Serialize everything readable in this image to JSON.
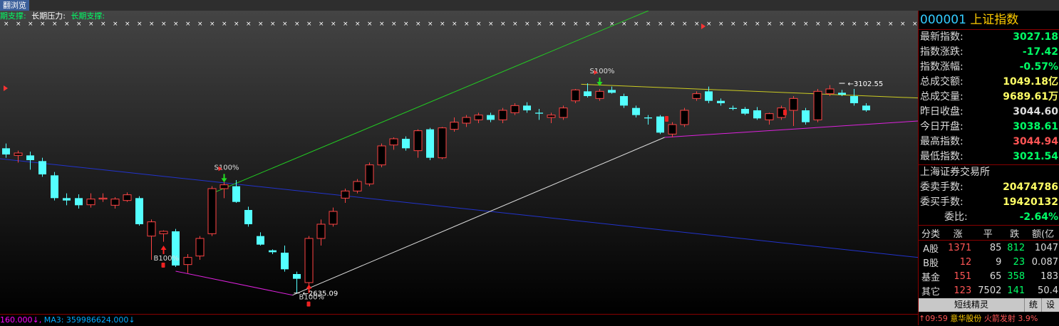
{
  "window": {
    "tab_label": "翻浏览"
  },
  "indicator_bar": {
    "items": [
      {
        "text": "期支撑:",
        "color": "#00ff66"
      },
      {
        "text": "长期压力:",
        "color": "#ffffff"
      },
      {
        "text": "长期支撑:",
        "color": "#00ff66"
      }
    ]
  },
  "chart_data": {
    "type": "candlestick",
    "ylim": [
      2600,
      3200
    ],
    "candles": [
      {
        "o": 2925,
        "h": 2935,
        "l": 2905,
        "c": 2912
      },
      {
        "o": 2910,
        "h": 2920,
        "l": 2895,
        "c": 2915
      },
      {
        "o": 2910,
        "h": 2918,
        "l": 2880,
        "c": 2900
      },
      {
        "o": 2898,
        "h": 2905,
        "l": 2865,
        "c": 2870
      },
      {
        "o": 2868,
        "h": 2875,
        "l": 2815,
        "c": 2820
      },
      {
        "o": 2820,
        "h": 2830,
        "l": 2805,
        "c": 2815
      },
      {
        "o": 2820,
        "h": 2828,
        "l": 2798,
        "c": 2805
      },
      {
        "o": 2806,
        "h": 2830,
        "l": 2800,
        "c": 2818
      },
      {
        "o": 2818,
        "h": 2830,
        "l": 2812,
        "c": 2820
      },
      {
        "o": 2805,
        "h": 2822,
        "l": 2798,
        "c": 2818
      },
      {
        "o": 2815,
        "h": 2832,
        "l": 2812,
        "c": 2827
      },
      {
        "o": 2820,
        "h": 2824,
        "l": 2762,
        "c": 2765
      },
      {
        "o": 2740,
        "h": 2775,
        "l": 2690,
        "c": 2770
      },
      {
        "o": 2745,
        "h": 2752,
        "l": 2728,
        "c": 2750
      },
      {
        "o": 2750,
        "h": 2755,
        "l": 2675,
        "c": 2678
      },
      {
        "o": 2680,
        "h": 2702,
        "l": 2662,
        "c": 2695
      },
      {
        "o": 2698,
        "h": 2740,
        "l": 2690,
        "c": 2735
      },
      {
        "o": 2745,
        "h": 2845,
        "l": 2740,
        "c": 2840
      },
      {
        "o": 2840,
        "h": 2860,
        "l": 2820,
        "c": 2848
      },
      {
        "o": 2845,
        "h": 2858,
        "l": 2810,
        "c": 2812
      },
      {
        "o": 2795,
        "h": 2802,
        "l": 2760,
        "c": 2765
      },
      {
        "o": 2740,
        "h": 2748,
        "l": 2720,
        "c": 2722
      },
      {
        "o": 2710,
        "h": 2712,
        "l": 2702,
        "c": 2706
      },
      {
        "o": 2705,
        "h": 2720,
        "l": 2665,
        "c": 2670
      },
      {
        "o": 2660,
        "h": 2665,
        "l": 2620,
        "c": 2650
      },
      {
        "o": 2642,
        "h": 2740,
        "l": 2635,
        "c": 2735
      },
      {
        "o": 2735,
        "h": 2775,
        "l": 2720,
        "c": 2765
      },
      {
        "o": 2765,
        "h": 2800,
        "l": 2760,
        "c": 2792
      },
      {
        "o": 2820,
        "h": 2840,
        "l": 2810,
        "c": 2835
      },
      {
        "o": 2835,
        "h": 2860,
        "l": 2830,
        "c": 2855
      },
      {
        "o": 2850,
        "h": 2895,
        "l": 2845,
        "c": 2890
      },
      {
        "o": 2890,
        "h": 2935,
        "l": 2885,
        "c": 2930
      },
      {
        "o": 2932,
        "h": 2948,
        "l": 2922,
        "c": 2945
      },
      {
        "o": 2945,
        "h": 2950,
        "l": 2920,
        "c": 2925
      },
      {
        "o": 2920,
        "h": 2965,
        "l": 2905,
        "c": 2962
      },
      {
        "o": 2965,
        "h": 2968,
        "l": 2900,
        "c": 2905
      },
      {
        "o": 2905,
        "h": 2970,
        "l": 2902,
        "c": 2968
      },
      {
        "o": 2965,
        "h": 2990,
        "l": 2960,
        "c": 2980
      },
      {
        "o": 2978,
        "h": 2995,
        "l": 2970,
        "c": 2990
      },
      {
        "o": 2985,
        "h": 3000,
        "l": 2978,
        "c": 2995
      },
      {
        "o": 2995,
        "h": 3000,
        "l": 2980,
        "c": 2985
      },
      {
        "o": 2985,
        "h": 3010,
        "l": 2978,
        "c": 3005
      },
      {
        "o": 3000,
        "h": 3020,
        "l": 2995,
        "c": 3015
      },
      {
        "o": 3015,
        "h": 3022,
        "l": 3000,
        "c": 3005
      },
      {
        "o": 3000,
        "h": 3008,
        "l": 2985,
        "c": 2998
      },
      {
        "o": 2990,
        "h": 3000,
        "l": 2978,
        "c": 2995
      },
      {
        "o": 2990,
        "h": 3015,
        "l": 2985,
        "c": 3010
      },
      {
        "o": 3025,
        "h": 3050,
        "l": 3020,
        "c": 3048
      },
      {
        "o": 3045,
        "h": 3062,
        "l": 3032,
        "c": 3035
      },
      {
        "o": 3030,
        "h": 3050,
        "l": 3025,
        "c": 3045
      },
      {
        "o": 3048,
        "h": 3055,
        "l": 3040,
        "c": 3042
      },
      {
        "o": 3035,
        "h": 3040,
        "l": 3010,
        "c": 3015
      },
      {
        "o": 3010,
        "h": 3015,
        "l": 2990,
        "c": 2995
      },
      {
        "o": 2990,
        "h": 2995,
        "l": 2975,
        "c": 2988
      },
      {
        "o": 2992,
        "h": 2995,
        "l": 2955,
        "c": 2958
      },
      {
        "o": 2955,
        "h": 2980,
        "l": 2948,
        "c": 2975
      },
      {
        "o": 2975,
        "h": 3010,
        "l": 2970,
        "c": 3005
      },
      {
        "o": 3030,
        "h": 3045,
        "l": 3025,
        "c": 3040
      },
      {
        "o": 3045,
        "h": 3055,
        "l": 3020,
        "c": 3025
      },
      {
        "o": 3025,
        "h": 3030,
        "l": 3015,
        "c": 3020
      },
      {
        "o": 3010,
        "h": 3015,
        "l": 3005,
        "c": 3008
      },
      {
        "o": 3008,
        "h": 3012,
        "l": 2995,
        "c": 2998
      },
      {
        "o": 3005,
        "h": 3012,
        "l": 2985,
        "c": 2988
      },
      {
        "o": 2985,
        "h": 3000,
        "l": 2975,
        "c": 2998
      },
      {
        "o": 2990,
        "h": 3015,
        "l": 2985,
        "c": 3010
      },
      {
        "o": 3005,
        "h": 3035,
        "l": 2972,
        "c": 3030
      },
      {
        "o": 3005,
        "h": 3010,
        "l": 2975,
        "c": 2980
      },
      {
        "o": 2985,
        "h": 3050,
        "l": 2980,
        "c": 3045
      },
      {
        "o": 3040,
        "h": 3058,
        "l": 3035,
        "c": 3050
      },
      {
        "o": 3042,
        "h": 3048,
        "l": 3035,
        "c": 3038
      },
      {
        "o": 3035,
        "h": 3050,
        "l": 3015,
        "c": 3020
      },
      {
        "o": 3015,
        "h": 3020,
        "l": 3002,
        "c": 3005
      }
    ],
    "annotations": [
      {
        "label": "B100%",
        "type": "buy",
        "index": 13,
        "price": 2708
      },
      {
        "label": "B100%",
        "type": "buy",
        "index": 25,
        "price": 2626
      },
      {
        "label": "S100%",
        "type": "sell",
        "index": 18,
        "price": 2862
      },
      {
        "label": "S100%",
        "type": "sell",
        "index": 49,
        "price": 3065
      }
    ],
    "price_labels": [
      {
        "text": "2635.09",
        "index": 24,
        "price": 2620
      },
      {
        "text": "3102.55",
        "index": 69,
        "price": 3062
      }
    ]
  },
  "bottom_strip": {
    "ma_left": "160.000",
    "ma3_label": "MA3: 359986624.000",
    "left_color": "#ff00ff",
    "ma3_color": "#00aaff"
  },
  "panel": {
    "code": "000001",
    "name": "上证指数",
    "quotes": [
      {
        "label": "最新指数:",
        "value": "3027.18",
        "color": "#00ff66"
      },
      {
        "label": "指数涨跌:",
        "value": "-17.42",
        "color": "#00ff66"
      },
      {
        "label": "指数涨幅:",
        "value": "-0.57%",
        "color": "#00ff66"
      },
      {
        "label": "总成交额:",
        "value": "1049.18亿",
        "color": "#ffff66"
      },
      {
        "label": "总成交量:",
        "value": "9689.61万",
        "color": "#ffff66"
      },
      {
        "label": "昨日收盘:",
        "value": "3044.60",
        "color": "#dddddd"
      },
      {
        "label": "今日开盘:",
        "value": "3038.61",
        "color": "#00ff66"
      },
      {
        "label": "最高指数:",
        "value": "3044.94",
        "color": "#ff5555"
      },
      {
        "label": "最低指数:",
        "value": "3021.54",
        "color": "#00ff66"
      }
    ],
    "exchange": "上海证券交易所",
    "orders": [
      {
        "label": "委卖手数:",
        "value": "20474786",
        "color": "#ffff66"
      },
      {
        "label": "委买手数:",
        "value": "19420132",
        "color": "#ffff66"
      },
      {
        "label": "委比:",
        "value": "-2.64%",
        "color": "#00ff66"
      }
    ],
    "category_headers": [
      "分类",
      "涨",
      "平",
      "跌",
      "额(亿"
    ],
    "categories": [
      {
        "name": "A股",
        "up": "1371",
        "flat": "85",
        "down": "812",
        "amount": "1047"
      },
      {
        "name": "B股",
        "up": "12",
        "flat": "9",
        "down": "23",
        "amount": "0.087"
      },
      {
        "name": "基金",
        "up": "151",
        "flat": "65",
        "down": "358",
        "amount": "183"
      },
      {
        "name": "其它",
        "up": "123",
        "flat": "7502",
        "down": "141",
        "amount": "50.4"
      }
    ],
    "buttons": {
      "main": "短线精灵",
      "stats": "统",
      "settings": "设"
    },
    "news": {
      "time": "↑09:59",
      "stock": "意华股份",
      "event": "火箭发射",
      "pct": "3.9%"
    }
  }
}
